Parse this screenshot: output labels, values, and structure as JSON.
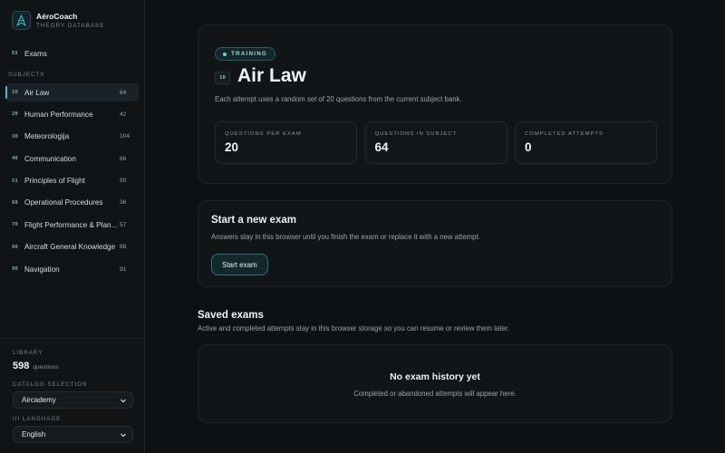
{
  "brand": {
    "name": "AéroCoach",
    "subtitle": "THEORY DATABASE"
  },
  "nav": {
    "exams": {
      "code": "EX",
      "label": "Exams"
    }
  },
  "sidebar": {
    "section_label": "SUBJECTS",
    "items": [
      {
        "code": "10",
        "label": "Air Law",
        "count": "64",
        "active": true
      },
      {
        "code": "20",
        "label": "Human Performance",
        "count": "42"
      },
      {
        "code": "30",
        "label": "Meteorologija",
        "count": "104"
      },
      {
        "code": "40",
        "label": "Communication",
        "count": "66"
      },
      {
        "code": "51",
        "label": "Principles of Flight",
        "count": "50"
      },
      {
        "code": "60",
        "label": "Operational Procedures",
        "count": "36"
      },
      {
        "code": "70",
        "label": "Flight Performance & Plan...",
        "count": "57"
      },
      {
        "code": "80",
        "label": "Aircraft General Knowledge",
        "count": "88"
      },
      {
        "code": "90",
        "label": "Navigation",
        "count": "91"
      }
    ]
  },
  "library": {
    "label": "LIBRARY",
    "count": "598",
    "unit": "questions"
  },
  "catalog": {
    "label": "CATALOG SELECTION",
    "value": "Aircademy"
  },
  "language": {
    "label": "UI LANGUAGE",
    "value": "English"
  },
  "hero": {
    "badge": "TRAINING",
    "code": "10",
    "title": "Air Law",
    "description": "Each attempt uses a random set of 20 questions from the current subject bank.",
    "stats": [
      {
        "label": "QUESTIONS PER EXAM",
        "value": "20"
      },
      {
        "label": "QUESTIONS IN SUBJECT",
        "value": "64"
      },
      {
        "label": "COMPLETED ATTEMPTS",
        "value": "0"
      }
    ]
  },
  "start": {
    "title": "Start a new exam",
    "description": "Answers stay in this browser until you finish the exam or replace it with a new attempt.",
    "button": "Start exam"
  },
  "saved": {
    "title": "Saved exams",
    "description": "Active and completed attempts stay in this browser storage so you can resume or review them later.",
    "empty_title": "No exam history yet",
    "empty_description": "Completed or abandoned attempts will appear here."
  },
  "colors": {
    "accent": "#4fb9c2",
    "background": "#0e1114"
  }
}
